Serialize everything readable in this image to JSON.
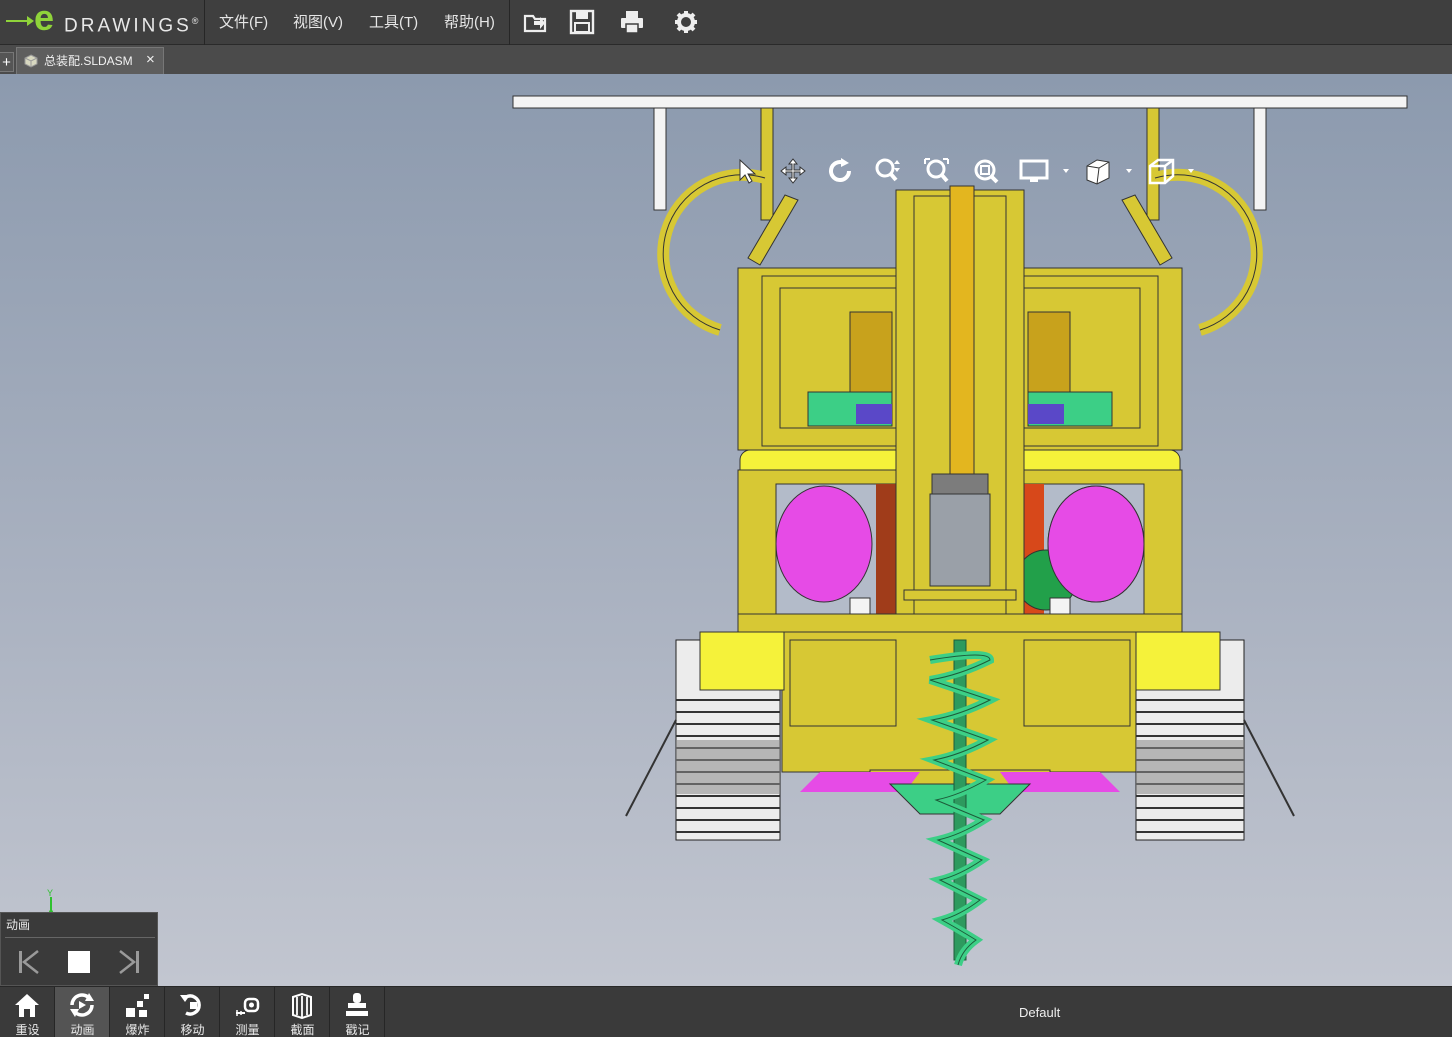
{
  "app": {
    "logo_letter": "e",
    "logo_word": "DRAWINGS",
    "logo_mark": "®"
  },
  "menu": [
    {
      "label": "文件(F)"
    },
    {
      "label": "视图(V)"
    },
    {
      "label": "工具(T)"
    },
    {
      "label": "帮助(H)"
    }
  ],
  "toolbar": {
    "icons": [
      "open-icon",
      "save-icon",
      "print-icon",
      "gear-icon"
    ]
  },
  "tab": {
    "add_label": "+",
    "file_name": "总装配.SLDASM",
    "close_label": "×"
  },
  "view_toolbar": {
    "icons": [
      "select-arrow-icon",
      "pan-icon",
      "rotate-icon",
      "zoom-icon",
      "zoom-to-fit-icon",
      "zoom-area-icon",
      "display-style-icon",
      "view-orientation-icon",
      "shaded-cube-icon"
    ]
  },
  "triad": {
    "y_label": "Y"
  },
  "animation_panel": {
    "title": "动画"
  },
  "bottom_bar": {
    "buttons": [
      {
        "label": "重设",
        "icon": "home-icon"
      },
      {
        "label": "动画",
        "icon": "animate-icon"
      },
      {
        "label": "爆炸",
        "icon": "explode-icon"
      },
      {
        "label": "移动",
        "icon": "move-icon"
      },
      {
        "label": "测量",
        "icon": "measure-icon"
      },
      {
        "label": "截面",
        "icon": "section-icon"
      },
      {
        "label": "戳记",
        "icon": "stamp-icon"
      }
    ],
    "active": "动画",
    "configuration": "Default"
  },
  "colors": {
    "accent": "#8fd33a",
    "bar": "#3f3f3f",
    "yellow": "#d7c834",
    "magenta": "#e64be6",
    "green": "#3db87a"
  }
}
